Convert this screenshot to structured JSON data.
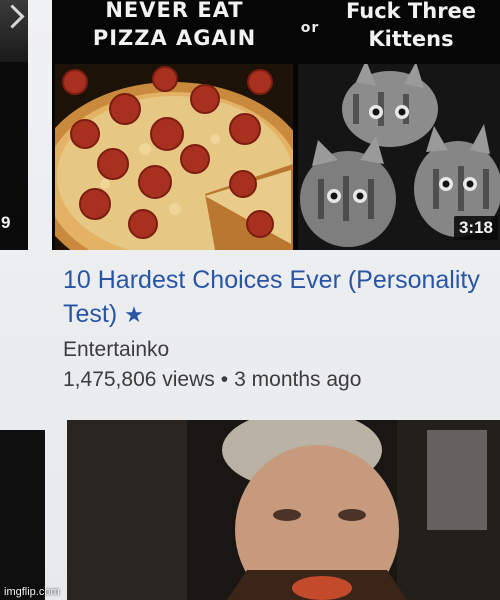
{
  "video": {
    "thumbnail": {
      "left_caption_line1": "NEVER EAT",
      "left_caption_line2": "PIZZA AGAIN",
      "or_text": "or",
      "right_caption_line1": "Fuck Three",
      "right_caption_line2": "Kittens",
      "duration": "3:18"
    },
    "title": "10 Hardest Choices Ever (Personality Test)",
    "title_icon": "star-icon",
    "channel": "Entertainko",
    "views": "1,475,806 views",
    "separator": "•",
    "age": "3 months ago"
  },
  "previous_video": {
    "duration_fragment": "9"
  },
  "watermark": "imgflip.com",
  "colors": {
    "title_link": "#2855a6",
    "meta_text": "#3c3c3c",
    "duration_bg": "#0a0a0a"
  }
}
